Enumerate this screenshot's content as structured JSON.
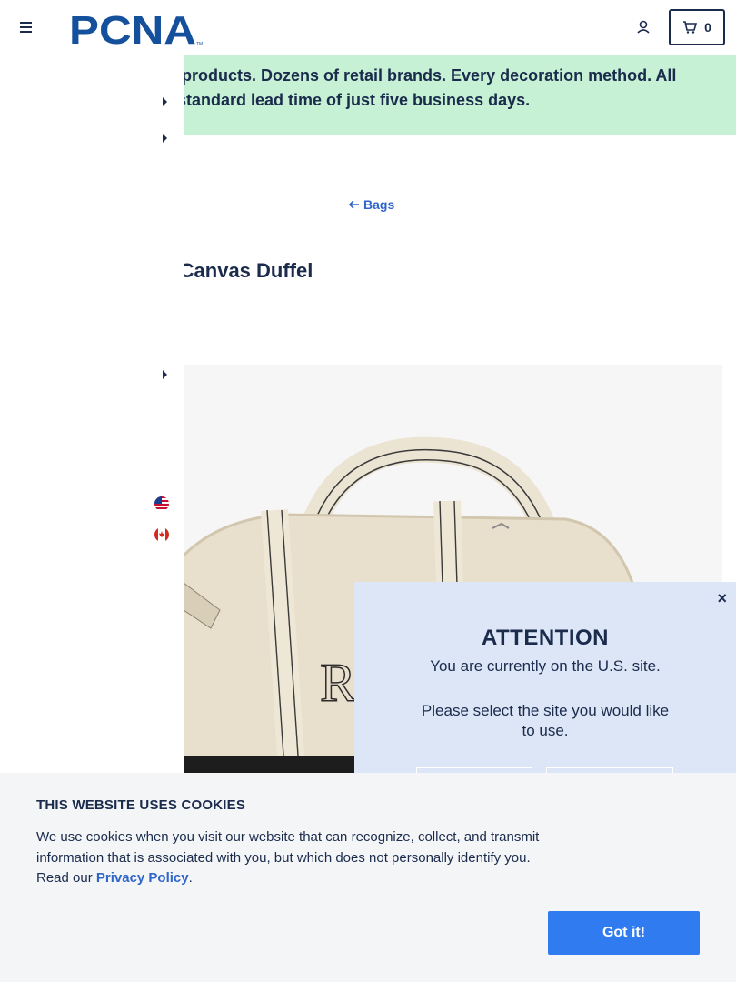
{
  "header": {
    "logo_text": "PCNA",
    "cart_count": "0",
    "colors": {
      "navy": "#1a2b4c",
      "accent": "#2f65c9"
    }
  },
  "promo": {
    "line1": "ls of products. Dozens of retail brands. Every decoration method. All",
    "line2": "th a standard lead time of just five business days.",
    "background": "#c6f1d4"
  },
  "breadcrumb": {
    "back_label": "Bags"
  },
  "product": {
    "title": "tton Canvas Duffel",
    "image_icon": "canvas-duffel-bag-image"
  },
  "site_selector": {
    "flags": [
      "us-flag-icon",
      "canada-flag-icon"
    ]
  },
  "modal": {
    "close_label": "×",
    "title": "ATTENTION",
    "line1": "You are currently on the U.S. site.",
    "line2": "Please select the site you would like to use."
  },
  "cookie_banner": {
    "title": "THIS WEBSITE USES COOKIES",
    "body": "We use cookies when you visit our website that can recognize, collect, and transmit information that is associated with you, but which does not personally identify you. Read our ",
    "link_label": "Privacy Policy",
    "period": ".",
    "button_label": "Got it!",
    "button_color": "#2f7bef"
  }
}
